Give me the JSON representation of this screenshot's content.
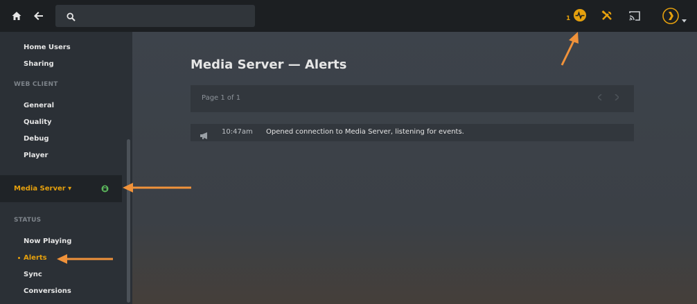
{
  "topbar": {
    "search": {
      "value": "",
      "placeholder": ""
    },
    "activity_count": "1"
  },
  "sidebar": {
    "items_top": [
      {
        "label": "Home Users"
      },
      {
        "label": "Sharing"
      }
    ],
    "web_client_heading": "WEB CLIENT",
    "web_client_items": [
      {
        "label": "General"
      },
      {
        "label": "Quality"
      },
      {
        "label": "Debug"
      },
      {
        "label": "Player"
      }
    ],
    "server_selector": {
      "label": "Media Server ▾"
    },
    "status_heading": "STATUS",
    "status_items": [
      {
        "label": "Now Playing"
      },
      {
        "label": "Alerts",
        "active": true
      },
      {
        "label": "Sync"
      },
      {
        "label": "Conversions"
      }
    ]
  },
  "main": {
    "title": "Media Server — Alerts",
    "pager": {
      "label": "Page 1 of 1"
    },
    "alerts": [
      {
        "time": "10:47am",
        "message": "Opened connection to Media Server, listening for events."
      }
    ]
  },
  "colors": {
    "accent": "#e5a00d",
    "annotation_arrow": "#f0923a",
    "topbar": "#1c1f22",
    "sidebar": "#2b3036",
    "lock": "#5cb85c"
  },
  "icons": {
    "home": "home-icon",
    "back": "arrow-left-icon",
    "search": "search-icon",
    "activity": "activity-icon",
    "settings": "tools-icon",
    "cast": "cast-icon",
    "user": "plex-logo-icon",
    "lock": "lock-icon",
    "alert": "megaphone-icon"
  }
}
